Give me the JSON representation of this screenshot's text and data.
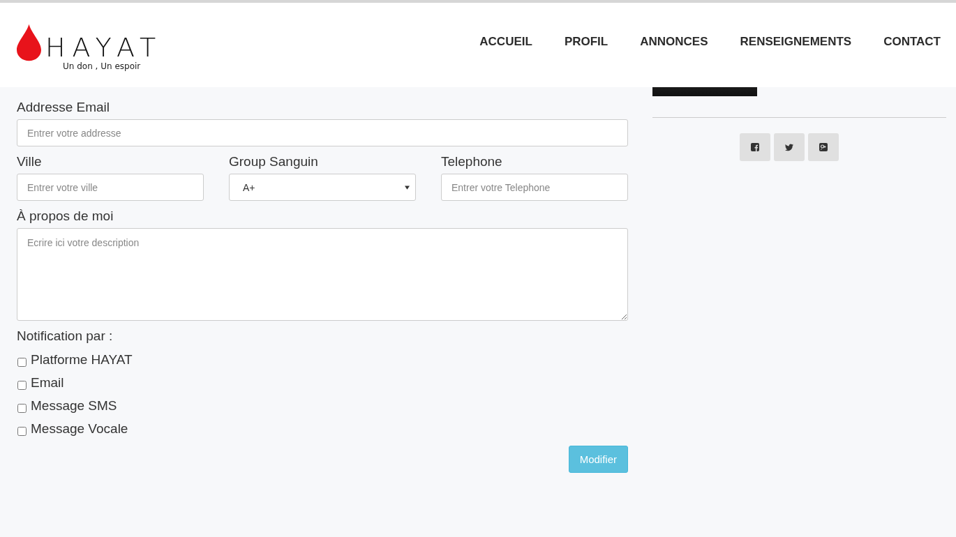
{
  "header": {
    "logo": {
      "name": "HAYAT",
      "tagline": "Un don , Un espoir"
    },
    "nav": [
      {
        "label": "ACCUEIL"
      },
      {
        "label": "PROFIL"
      },
      {
        "label": "ANNONCES"
      },
      {
        "label": "RENSEIGNEMENTS"
      },
      {
        "label": "CONTACT"
      }
    ]
  },
  "form": {
    "email": {
      "label": "Addresse Email",
      "placeholder": "Entrer votre addresse"
    },
    "row": [
      {
        "kind": "input",
        "label": "Ville",
        "placeholder": "Entrer votre ville"
      },
      {
        "kind": "select",
        "label": "Group Sanguin",
        "value": "A+"
      },
      {
        "kind": "input",
        "label": "Telephone",
        "placeholder": "Entrer votre Telephone"
      }
    ],
    "about": {
      "label": "À propos de moi",
      "placeholder": "Ecrire ici votre description"
    },
    "notification": {
      "label": "Notification par :",
      "options": [
        {
          "label": "Platforme HAYAT",
          "checked": false
        },
        {
          "label": "Email",
          "checked": false
        },
        {
          "label": "Message SMS",
          "checked": false
        },
        {
          "label": "Message Vocale",
          "checked": false
        }
      ]
    },
    "submit": "Modifier"
  },
  "social": [
    {
      "kind": "facebook"
    },
    {
      "kind": "twitter"
    },
    {
      "kind": "googleplus"
    }
  ]
}
